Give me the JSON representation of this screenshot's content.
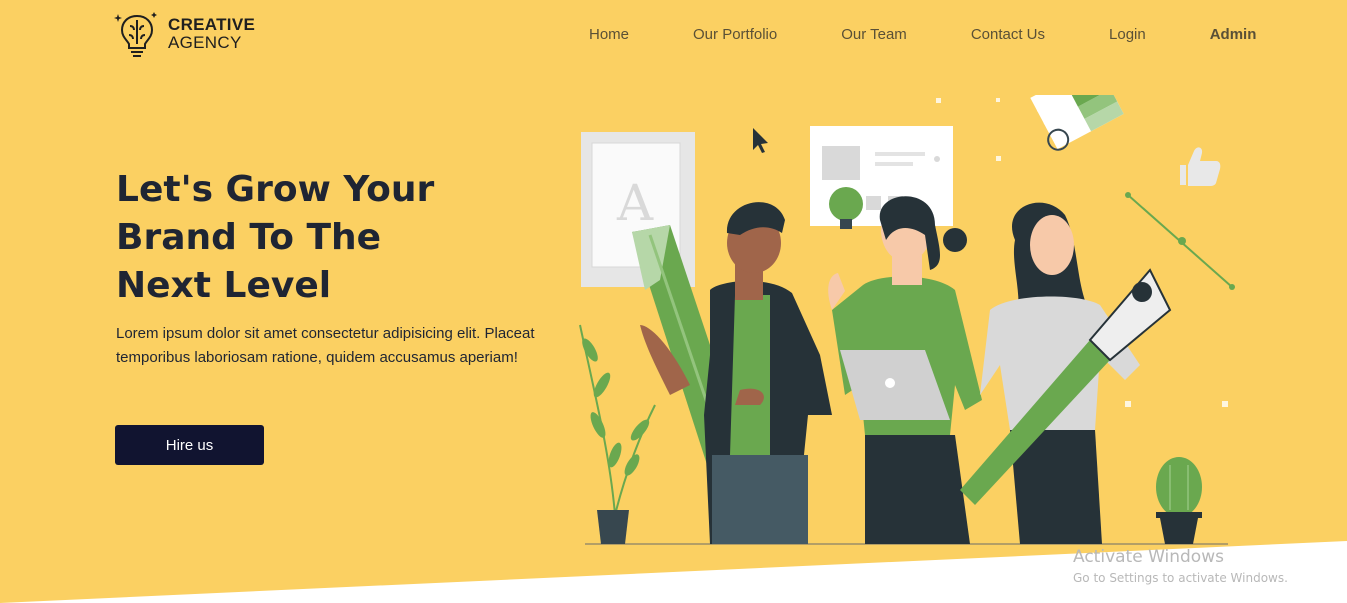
{
  "brand": {
    "line1": "CREATIVE",
    "line2": "AGENCY"
  },
  "nav": {
    "items": [
      "Home",
      "Our Portfolio",
      "Our Team",
      "Contact Us",
      "Login"
    ],
    "admin": "Admin"
  },
  "hero": {
    "title_lines": [
      "Let's Grow Your",
      "Brand To The",
      "Next Level"
    ],
    "description": "Lorem ipsum dolor sit amet consectetur adipisicing elit. Placeat temporibus laboriosam ratione, quidem accusamus aperiam!",
    "button_label": "Hire us"
  },
  "watermark": {
    "title": "Activate Windows",
    "subtitle": "Go to Settings to activate Windows."
  },
  "colors": {
    "background": "#fbd062",
    "button": "#111430",
    "text_dark": "#1f2533",
    "accent_green": "#6aa84f"
  }
}
